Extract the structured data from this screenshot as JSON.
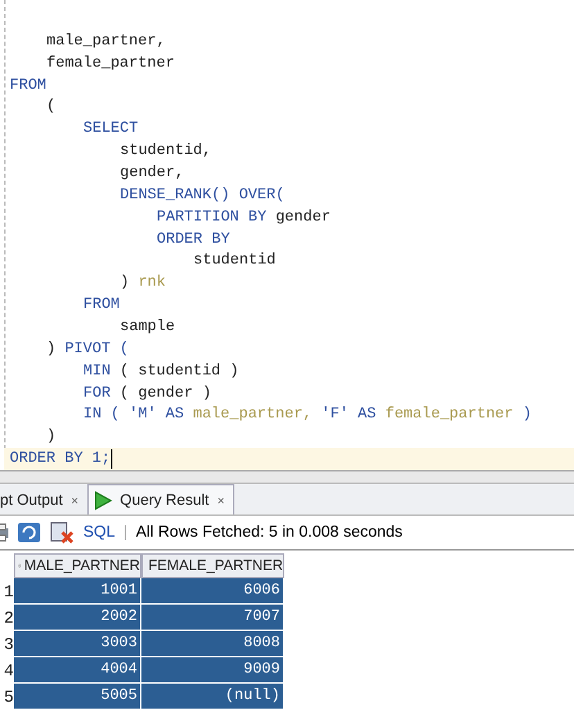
{
  "editor": {
    "lines": [
      {
        "children": [
          {
            "tokens": [
              {
                "kind": "plain",
                "text": "male_partner,"
              }
            ]
          },
          {
            "tokens": [
              {
                "kind": "plain",
                "text": "female_partner"
              }
            ]
          }
        ]
      },
      {
        "tokens": [
          {
            "kind": "keyword",
            "text": "FROM"
          }
        ],
        "children": [
          {
            "tokens": [
              {
                "kind": "plain",
                "text": "("
              }
            ],
            "children": [
              {
                "tokens": [
                  {
                    "kind": "keyword",
                    "text": "SELECT"
                  }
                ],
                "children": [
                  {
                    "tokens": [
                      {
                        "kind": "plain",
                        "text": "studentid,"
                      }
                    ]
                  },
                  {
                    "tokens": [
                      {
                        "kind": "plain",
                        "text": "gender,"
                      }
                    ]
                  },
                  {
                    "tokens": [
                      {
                        "kind": "keyword",
                        "text": "DENSE_RANK() OVER("
                      }
                    ],
                    "children": [
                      {
                        "tokens": [
                          {
                            "kind": "keyword",
                            "text": "PARTITION BY"
                          },
                          {
                            "kind": "plain",
                            "text": "gender"
                          }
                        ]
                      },
                      {
                        "tokens": [
                          {
                            "kind": "keyword",
                            "text": "ORDER BY"
                          }
                        ],
                        "children": [
                          {
                            "tokens": [
                              {
                                "kind": "plain",
                                "text": "studentid"
                              }
                            ]
                          }
                        ]
                      }
                    ]
                  },
                  {
                    "tokens": [
                      {
                        "kind": "plain",
                        "text": ")"
                      },
                      {
                        "kind": "alias",
                        "text": "rnk"
                      }
                    ]
                  }
                ]
              },
              {
                "tokens": [
                  {
                    "kind": "keyword",
                    "text": "FROM"
                  }
                ],
                "children": [
                  {
                    "tokens": [
                      {
                        "kind": "plain",
                        "text": "sample"
                      }
                    ]
                  }
                ]
              }
            ]
          },
          {
            "tokens": [
              {
                "kind": "plain",
                "text": ")"
              },
              {
                "kind": "keyword",
                "text": "PIVOT ("
              }
            ],
            "children": [
              {
                "tokens": [
                  {
                    "kind": "keyword",
                    "text": "MIN"
                  },
                  {
                    "kind": "plain",
                    "text": "( studentid )"
                  }
                ]
              },
              {
                "tokens": [
                  {
                    "kind": "keyword",
                    "text": "FOR"
                  },
                  {
                    "kind": "plain",
                    "text": "( gender )"
                  }
                ]
              },
              {
                "tokens": [
                  {
                    "kind": "keyword",
                    "text": "IN ( 'M' AS"
                  },
                  {
                    "kind": "alias",
                    "text": "male_partner,"
                  },
                  {
                    "kind": "keyword",
                    "text": "'F' AS"
                  },
                  {
                    "kind": "alias",
                    "text": "female_partner"
                  },
                  {
                    "kind": "keyword",
                    "text": ")"
                  }
                ]
              }
            ]
          },
          {
            "tokens": [
              {
                "kind": "plain",
                "text": ")"
              }
            ]
          }
        ]
      },
      {
        "current": true,
        "tokens": [
          {
            "kind": "keyword",
            "text": "ORDER BY 1;"
          }
        ]
      }
    ]
  },
  "tabs": [
    {
      "label": "pt Output",
      "close": "×",
      "selected": false
    },
    {
      "label": "Query Result",
      "close": "×",
      "selected": true
    }
  ],
  "toolbar": {
    "sql": "SQL",
    "separator": "|",
    "status": "All Rows Fetched: 5 in 0.008 seconds"
  },
  "grid": {
    "columns": [
      "MALE_PARTNER",
      "FEMALE_PARTNER"
    ],
    "rows": [
      {
        "number": "1",
        "cells": [
          "1001",
          "6006"
        ],
        "selected": true
      },
      {
        "number": "2",
        "cells": [
          "2002",
          "7007"
        ],
        "selected": true
      },
      {
        "number": "3",
        "cells": [
          "3003",
          "8008"
        ],
        "selected": true
      },
      {
        "number": "4",
        "cells": [
          "4004",
          "9009"
        ],
        "selected": true
      },
      {
        "number": "5",
        "cells": [
          "5005",
          "(null)"
        ],
        "selected": true
      }
    ]
  }
}
